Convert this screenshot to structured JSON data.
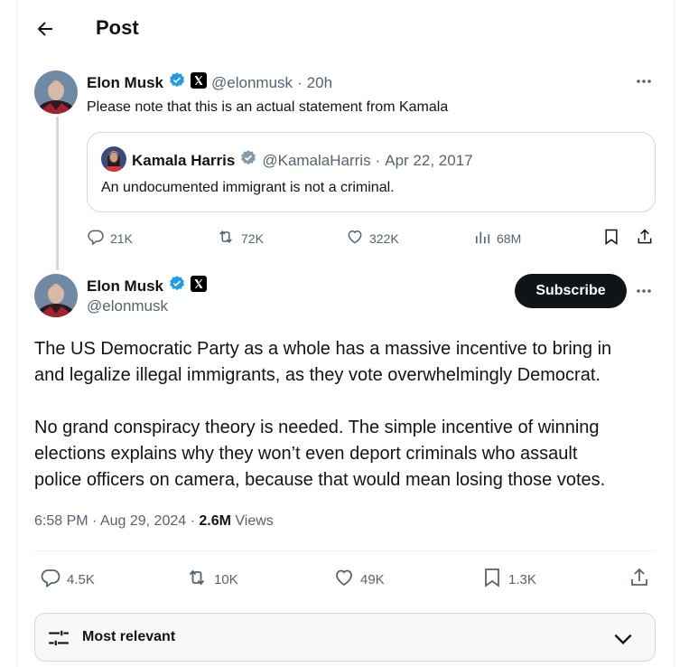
{
  "header": {
    "title": "Post"
  },
  "parent_post": {
    "author_name": "Elon Musk",
    "author_handle": "@elonmusk",
    "time": "20h",
    "text": "Please note that this is an actual statement from Kamala",
    "quote": {
      "author_name": "Kamala Harris",
      "author_handle": "@KamalaHarris",
      "date": "Apr 22, 2017",
      "text": "An undocumented immigrant is not a criminal."
    },
    "stats": {
      "replies": "21K",
      "reposts": "72K",
      "likes": "322K",
      "views": "68M"
    }
  },
  "main_post": {
    "author_name": "Elon Musk",
    "author_handle": "@elonmusk",
    "subscribe_label": "Subscribe",
    "paragraph1_line1": "The US Democratic Party as a whole has a massive incentive to bring in",
    "paragraph1_line2": "and legalize illegal immigrants, as they vote overwhelmingly Democrat.",
    "paragraph2_line1": "No grand conspiracy theory is needed. The simple incentive of winning",
    "paragraph2_line2": "elections explains why they won’t even deport criminals who assault",
    "paragraph2_line3": "police officers on camera, because that would mean losing those votes.",
    "time": "6:58 PM",
    "date": "Aug 29, 2024",
    "views_count": "2.6M",
    "views_label": "Views",
    "stats": {
      "replies": "4.5K",
      "reposts": "10K",
      "likes": "49K",
      "bookmarks": "1.3K"
    }
  },
  "sort": {
    "label": "Most relevant"
  },
  "colors": {
    "verified": "#1d9bf0",
    "quote_verified": "#829aab",
    "text": "#0f1419",
    "muted": "#536471"
  },
  "icons": [
    "back-arrow-icon",
    "verified-badge-icon",
    "x-logo-icon",
    "more-icon",
    "reply-icon",
    "repost-icon",
    "like-icon",
    "views-icon",
    "bookmark-icon",
    "share-icon",
    "sort-sliders-icon",
    "chevron-down-icon"
  ]
}
